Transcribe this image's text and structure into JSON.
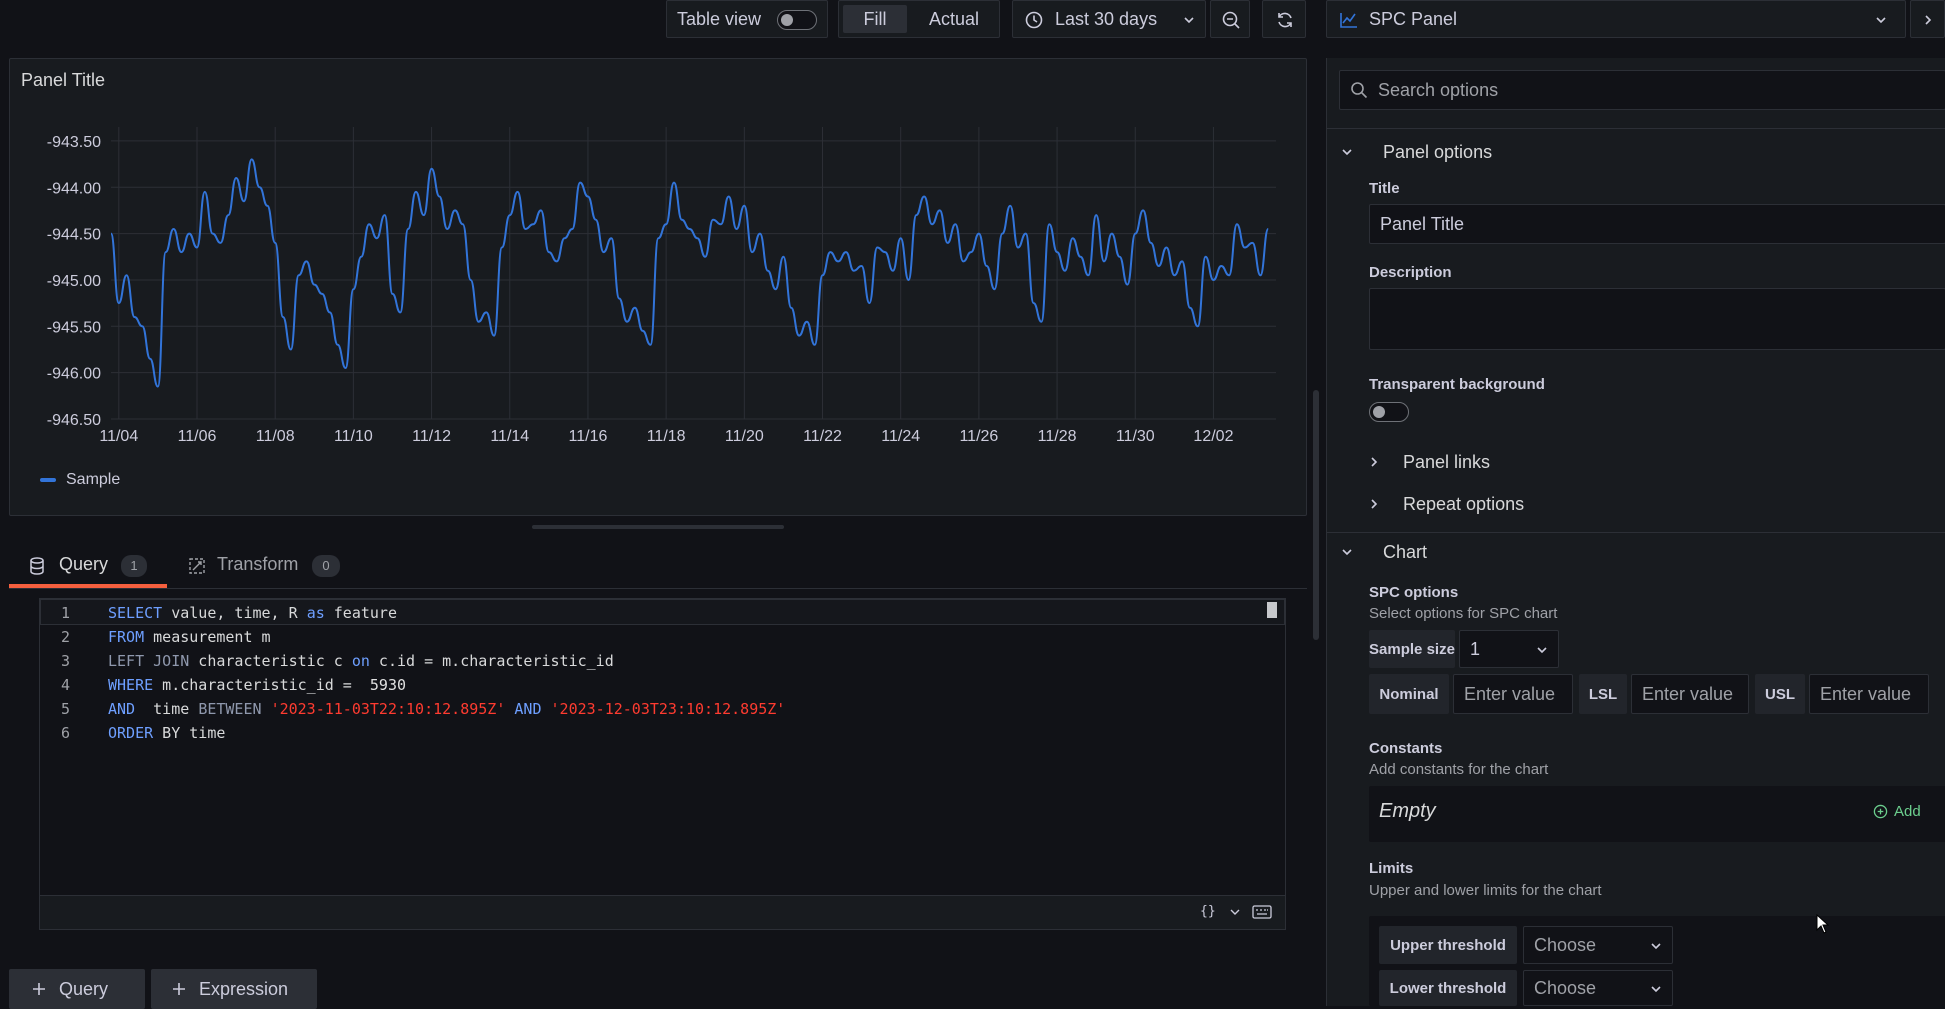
{
  "toolbar": {
    "table_view_label": "Table view",
    "fill_label": "Fill",
    "actual_label": "Actual",
    "time_range_label": "Last 30 days",
    "viz_name": "SPC Panel"
  },
  "panel": {
    "title": "Panel Title",
    "legend_label": "Sample"
  },
  "chart_data": {
    "type": "line",
    "ylim": [
      -946.5,
      -943.35
    ],
    "y_ticks": [
      "-943.50",
      "-944.00",
      "-944.50",
      "-945.00",
      "-945.50",
      "-946.00",
      "-946.50"
    ],
    "x_ticks": [
      "11/04",
      "11/06",
      "11/08",
      "11/10",
      "11/12",
      "11/14",
      "11/16",
      "11/18",
      "11/20",
      "11/22",
      "11/24",
      "11/26",
      "11/28",
      "11/30",
      "12/02"
    ],
    "x_range_days": [
      -0.2,
      29.6
    ],
    "series": [
      {
        "name": "Sample",
        "color": "#3274d9",
        "x_days": [
          -0.2,
          0.0,
          0.2,
          0.4,
          0.6,
          0.8,
          1.0,
          1.2,
          1.4,
          1.6,
          1.8,
          2.0,
          2.2,
          2.4,
          2.6,
          2.8,
          3.0,
          3.2,
          3.4,
          3.6,
          3.8,
          4.0,
          4.2,
          4.4,
          4.6,
          4.8,
          5.0,
          5.2,
          5.4,
          5.6,
          5.8,
          6.0,
          6.2,
          6.4,
          6.6,
          6.8,
          7.0,
          7.2,
          7.4,
          7.6,
          7.8,
          8.0,
          8.2,
          8.4,
          8.6,
          8.8,
          9.0,
          9.2,
          9.4,
          9.6,
          9.8,
          10.0,
          10.2,
          10.4,
          10.6,
          10.8,
          11.0,
          11.2,
          11.4,
          11.6,
          11.8,
          12.0,
          12.2,
          12.4,
          12.6,
          12.8,
          13.0,
          13.2,
          13.4,
          13.6,
          13.8,
          14.0,
          14.2,
          14.4,
          14.6,
          14.8,
          15.0,
          15.2,
          15.4,
          15.6,
          15.8,
          16.0,
          16.2,
          16.4,
          16.6,
          16.8,
          17.0,
          17.2,
          17.4,
          17.6,
          17.8,
          18.0,
          18.2,
          18.4,
          18.6,
          18.8,
          19.0,
          19.2,
          19.4,
          19.6,
          19.8,
          20.0,
          20.2,
          20.4,
          20.6,
          20.8,
          21.0,
          21.2,
          21.4,
          21.6,
          21.8,
          22.0,
          22.2,
          22.4,
          22.6,
          22.8,
          23.0,
          23.2,
          23.4,
          23.6,
          23.8,
          24.0,
          24.2,
          24.4,
          24.6,
          24.8,
          25.0,
          25.2,
          25.4,
          25.6,
          25.8,
          26.0,
          26.2,
          26.4,
          26.6,
          26.8,
          27.0,
          27.2,
          27.4,
          27.6,
          27.8,
          28.0,
          28.2,
          28.4,
          28.6,
          28.8,
          29.0,
          29.2,
          29.4,
          29.6
        ],
        "values": [
          -944.5,
          -945.25,
          -944.95,
          -945.4,
          -945.5,
          -945.85,
          -946.15,
          -944.7,
          -944.45,
          -944.7,
          -944.5,
          -944.65,
          -944.05,
          -944.5,
          -944.6,
          -944.3,
          -943.9,
          -944.15,
          -943.7,
          -944.0,
          -944.2,
          -944.6,
          -945.4,
          -945.75,
          -944.95,
          -944.8,
          -945.05,
          -945.15,
          -945.35,
          -945.7,
          -945.95,
          -945.1,
          -944.75,
          -944.4,
          -944.55,
          -944.3,
          -945.15,
          -945.35,
          -944.45,
          -944.05,
          -944.3,
          -943.8,
          -944.1,
          -944.45,
          -944.25,
          -944.4,
          -945.0,
          -945.45,
          -945.35,
          -945.6,
          -944.65,
          -944.3,
          -944.05,
          -944.45,
          -944.4,
          -944.25,
          -944.7,
          -944.8,
          -944.55,
          -944.45,
          -943.95,
          -944.1,
          -944.35,
          -944.7,
          -944.55,
          -945.2,
          -945.45,
          -945.3,
          -945.55,
          -945.7,
          -944.55,
          -944.4,
          -943.95,
          -944.35,
          -944.45,
          -944.55,
          -944.75,
          -944.35,
          -944.4,
          -944.1,
          -944.45,
          -944.2,
          -944.7,
          -944.5,
          -944.9,
          -945.1,
          -944.75,
          -945.3,
          -945.6,
          -945.45,
          -945.7,
          -944.95,
          -944.7,
          -944.8,
          -944.7,
          -944.9,
          -944.85,
          -945.25,
          -944.65,
          -944.7,
          -944.9,
          -944.55,
          -945.0,
          -944.3,
          -944.1,
          -944.4,
          -944.25,
          -944.6,
          -944.4,
          -944.8,
          -944.7,
          -944.5,
          -944.85,
          -945.1,
          -944.5,
          -944.2,
          -944.65,
          -944.5,
          -945.25,
          -945.45,
          -944.4,
          -944.7,
          -944.9,
          -944.55,
          -944.75,
          -944.95,
          -944.3,
          -944.8,
          -944.5,
          -944.75,
          -945.05,
          -944.5,
          -944.25,
          -944.6,
          -944.85,
          -944.65,
          -944.95,
          -944.8,
          -945.3,
          -945.5,
          -944.75,
          -945.0,
          -944.85,
          -944.95,
          -944.4,
          -944.65,
          -944.6,
          -944.95,
          -944.45
        ]
      }
    ]
  },
  "query_tabs": [
    {
      "label": "Query",
      "count": "1"
    },
    {
      "label": "Transform",
      "count": "0"
    }
  ],
  "editor": {
    "lines": [
      {
        "n": "1",
        "tokens": [
          [
            "kw",
            "SELECT"
          ],
          [
            "plain",
            " value, time, R "
          ],
          [
            "kw",
            "as"
          ],
          [
            "plain",
            " feature"
          ]
        ]
      },
      {
        "n": "2",
        "tokens": [
          [
            "kw",
            "FROM"
          ],
          [
            "plain",
            " measurement m"
          ]
        ]
      },
      {
        "n": "3",
        "tokens": [
          [
            "kw2",
            "LEFT JOIN"
          ],
          [
            "plain",
            " characteristic c "
          ],
          [
            "kw",
            "on"
          ],
          [
            "plain",
            " c.id = m.characteristic_id"
          ]
        ]
      },
      {
        "n": "4",
        "tokens": [
          [
            "kw",
            "WHERE"
          ],
          [
            "plain",
            " m.characteristic_id =  "
          ],
          [
            "num",
            "5930"
          ]
        ]
      },
      {
        "n": "5",
        "tokens": [
          [
            "kw",
            "AND"
          ],
          [
            "plain",
            "  time "
          ],
          [
            "kw2",
            "BETWEEN"
          ],
          [
            "plain",
            " "
          ],
          [
            "str",
            "'2023-11-03T22:10:12.895Z'"
          ],
          [
            "plain",
            " "
          ],
          [
            "kw",
            "AND"
          ],
          [
            "plain",
            " "
          ],
          [
            "str",
            "'2023-12-03T23:10:12.895Z'"
          ]
        ]
      },
      {
        "n": "6",
        "tokens": [
          [
            "kw",
            "ORDER"
          ],
          [
            "plain",
            " BY time"
          ]
        ]
      }
    ],
    "footer_format": "{}"
  },
  "bottom_buttons": {
    "query_label": "Query",
    "expression_label": "Expression"
  },
  "options": {
    "search_placeholder": "Search options",
    "panel_options_label": "Panel options",
    "title_label": "Title",
    "title_value": "Panel Title",
    "description_label": "Description",
    "transparent_label": "Transparent background",
    "panel_links_label": "Panel links",
    "repeat_options_label": "Repeat options",
    "chart_label": "Chart",
    "spc_label": "SPC options",
    "spc_desc": "Select options for SPC chart",
    "sample_size_label": "Sample size",
    "sample_size_value": "1",
    "nominal_label": "Nominal",
    "lsl_label": "LSL",
    "usl_label": "USL",
    "enter_value_placeholder": "Enter value",
    "constants_label": "Constants",
    "constants_desc": "Add constants for the chart",
    "constants_empty": "Empty",
    "add_label": "Add",
    "limits_label": "Limits",
    "limits_desc": "Upper and lower limits for the chart",
    "upper_threshold_label": "Upper threshold",
    "lower_threshold_label": "Lower threshold",
    "choose_label": "Choose"
  }
}
